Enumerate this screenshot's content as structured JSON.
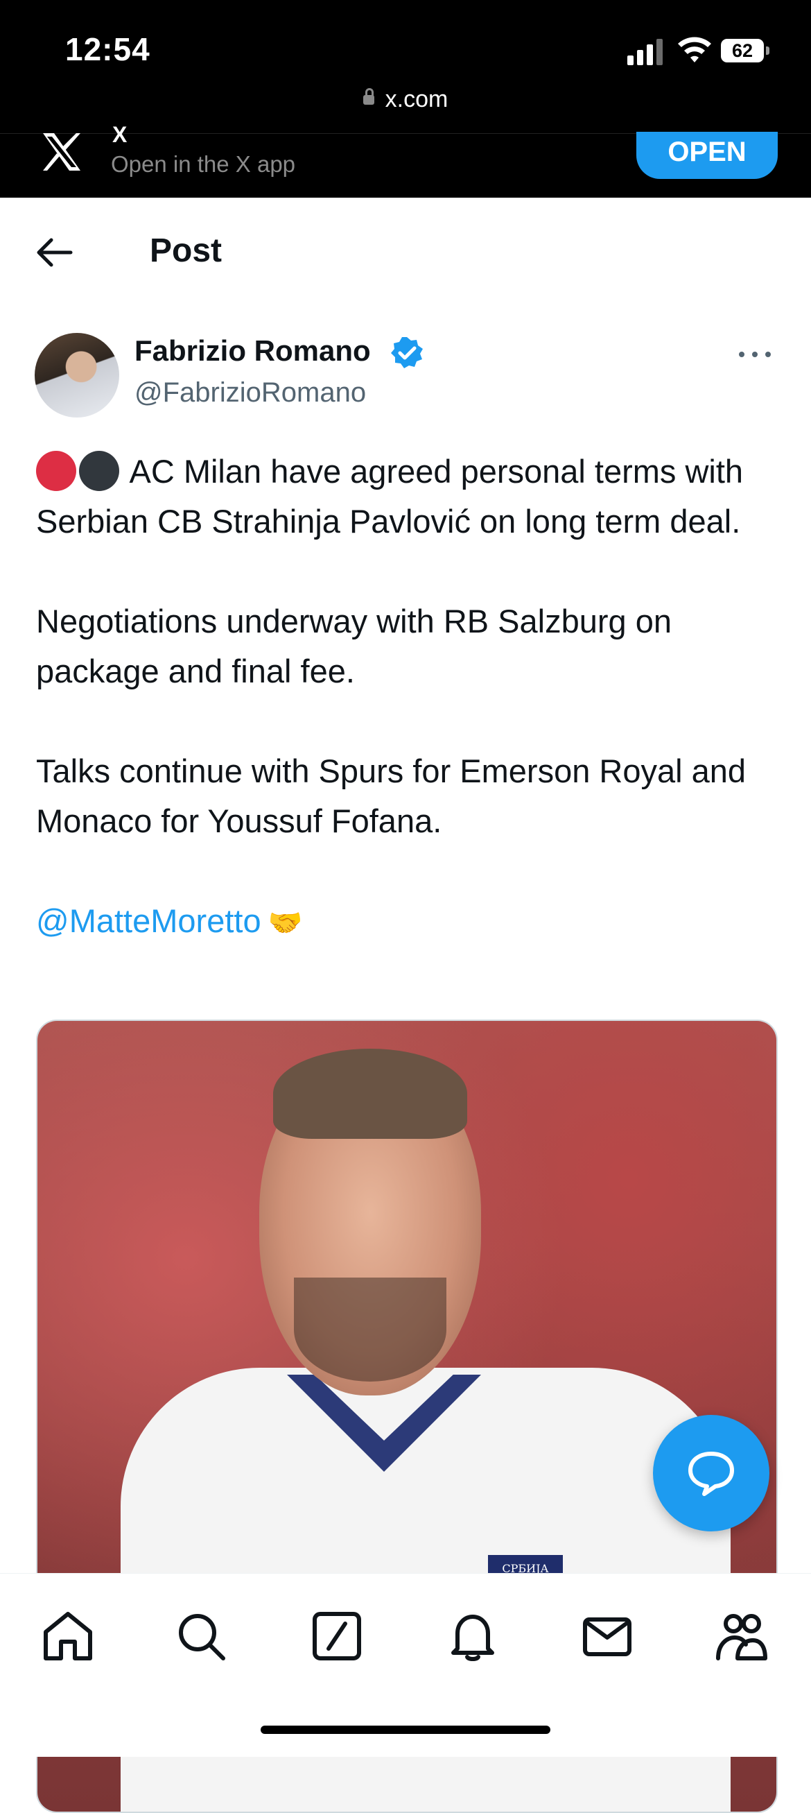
{
  "status_bar": {
    "time": "12:54",
    "battery": "62"
  },
  "browser": {
    "url": "x.com"
  },
  "app_banner": {
    "title": "X",
    "subtitle": "Open in the X app",
    "open_label": "OPEN"
  },
  "header": {
    "title": "Post"
  },
  "post": {
    "author_name": "Fabrizio Romano",
    "author_handle": "@FabrizioRomano",
    "paragraph1": "AC Milan have agreed personal terms with Serbian CB Strahinja Pavlović on long term deal.",
    "paragraph2": "Negotiations underway with RB Salzburg on package and final fee.",
    "paragraph3": "Talks continue with Spurs for Emerson Royal and Monaco for Youssuf Fofana.",
    "mention": "@MatteMoretto",
    "handshake_emoji": "🤝",
    "image_crest_text": "СРБИЈА"
  },
  "colors": {
    "accent": "#1d9bf0",
    "text": "#0f1419",
    "secondary": "#536471"
  },
  "icons": {
    "nav": [
      "home-icon",
      "search-icon",
      "grok-icon",
      "notifications-icon",
      "messages-icon",
      "communities-icon"
    ],
    "fab": "new-post-icon"
  }
}
